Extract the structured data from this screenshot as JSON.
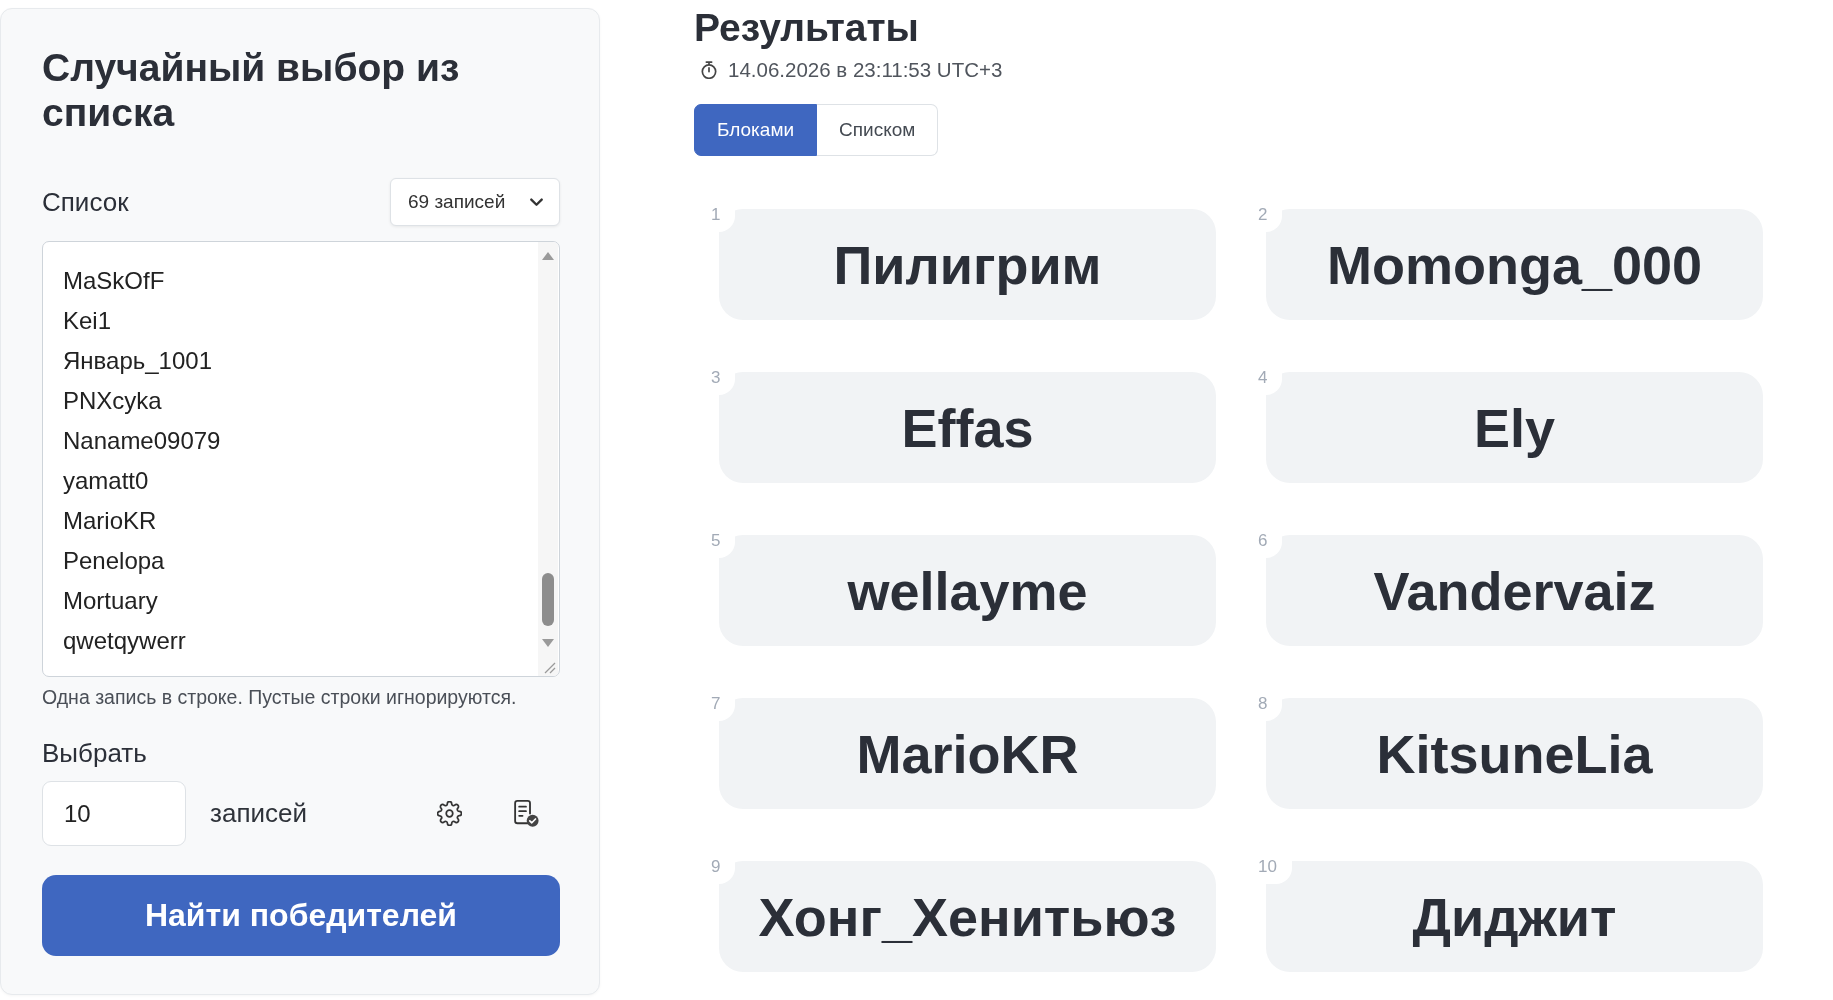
{
  "sidebar": {
    "title": "Случайный выбор из списка",
    "list_label": "Список",
    "count_dropdown": {
      "label": "69 записей"
    },
    "entries": [
      "MaSkOfF",
      "Kei1",
      "Январь_1001",
      "PNXcyka",
      "Naname09079",
      "yamatt0",
      "MarioKR",
      "Penelopa",
      "Mortuary",
      "qwetqywerr"
    ],
    "hint": "Одна запись в строке. Пустые строки игнорируются.",
    "pick_label": "Выбрать",
    "pick_count": {
      "value": "10"
    },
    "pick_unit": "записей",
    "submit_button": "Найти победителей"
  },
  "results": {
    "title": "Результаты",
    "timestamp": "14.06.2026 в 23:11:53 UTC+3",
    "view_tabs": [
      {
        "label": "Блоками",
        "selected": true
      },
      {
        "label": "Списком",
        "selected": false
      }
    ],
    "winners": [
      {
        "number": "1",
        "name": "Пилигрим"
      },
      {
        "number": "2",
        "name": "Momonga_000"
      },
      {
        "number": "3",
        "name": "Effas"
      },
      {
        "number": "4",
        "name": "Ely"
      },
      {
        "number": "5",
        "name": "wellayme"
      },
      {
        "number": "6",
        "name": "Vandervaiz"
      },
      {
        "number": "7",
        "name": "MarioKR"
      },
      {
        "number": "8",
        "name": "KitsuneLia"
      },
      {
        "number": "9",
        "name": "Хонг_Хенитьюз"
      },
      {
        "number": "10",
        "name": "Диджит"
      }
    ]
  }
}
